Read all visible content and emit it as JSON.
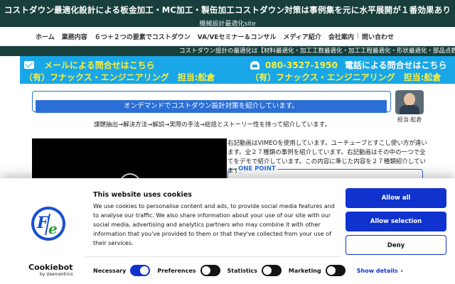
{
  "header": {
    "headline": "コストダウン最適化設計による板金加工・MC加工・製缶加工コストダウン対策は事例集を元に水平展開が１番効果あり",
    "subline": "機械設計最適化site"
  },
  "nav": {
    "items": [
      "ホーム",
      "業務内容",
      "６つ＋２つの要素でコストダウン",
      "VA/VEセミナー＆コンサル",
      "メディア紹介",
      "会社案内",
      "問い合わせ"
    ]
  },
  "ticker": "コストダウン設計の最適化は【材料最適化・加工工数最適化・加工工程最適化・形状最適化・部品点数削減",
  "banners": {
    "mail_title": "メールによる問合せはこちら",
    "mail_company": "（有）フナックス・エンジニアリング　担当:舩倉",
    "tel_number": "080-3527-1950",
    "tel_title": "電話による問合せはこちら",
    "tel_company": "（有）フナックス・エンジニアリング　担当:舩倉"
  },
  "intro": {
    "bar": "オンデマンドでコストダウン設計対策を紹介しています。",
    "avatar_label": "担当:舩倉",
    "process": "課題抽出→解決方法→解説→実際の手法→総括とストーリー性を持って紹介しています。"
  },
  "content": {
    "desc": "右記動画はVIMEOを使用しています。ユーチューブとすこし使い方が違います。全２７種類の事例を紹介しています。右記動画はその中の一つで全てをデモで紹介しています。この内容に準じた内容を２７種類紹介しています。",
    "onepoint": "ONE POINT"
  },
  "cookie": {
    "logo_text": "Cookiebot",
    "logo_sub": "by Usercentrics",
    "title": "This website uses cookies",
    "body": "We use cookies to personalise content and ads, to provide social media features and to analyse our traffic. We also share information about your use of our site with our social media, advertising and analytics partners who may combine it with other information that you've provided to them or that they've collected from your use of their services.",
    "allow_all": "Allow all",
    "allow_selection": "Allow selection",
    "deny": "Deny",
    "toggles": {
      "necessary": "Necessary",
      "preferences": "Preferences",
      "statistics": "Statistics",
      "marketing": "Marketing"
    },
    "show_details": "Show details",
    "accent": "#1032cf"
  }
}
